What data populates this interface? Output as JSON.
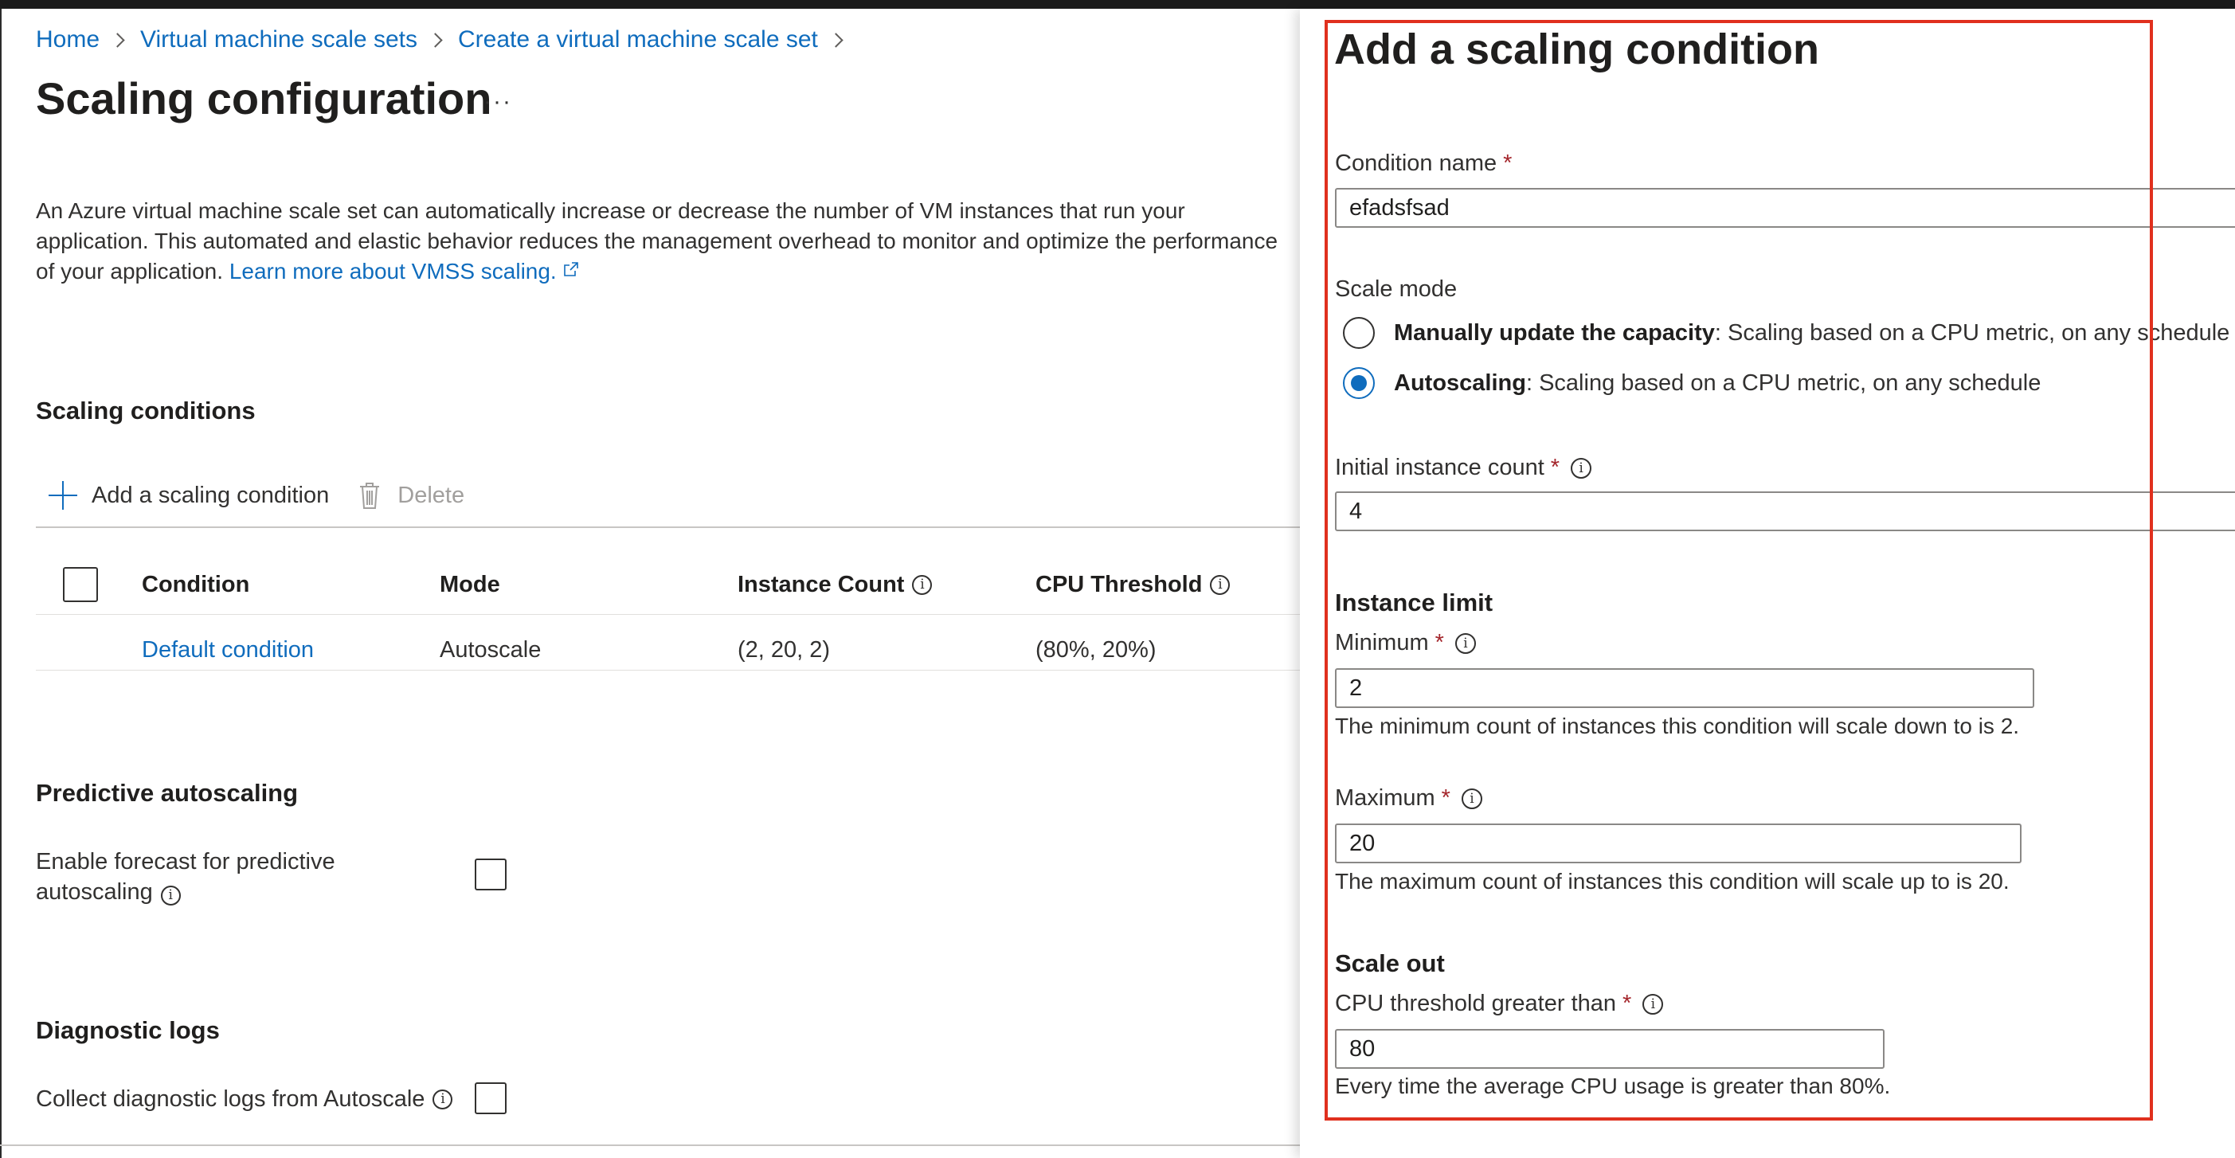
{
  "breadcrumb": {
    "home": "Home",
    "scale_sets": "Virtual machine scale sets",
    "create": "Create a virtual machine scale set"
  },
  "page": {
    "title": "Scaling configuration",
    "more": "···",
    "description_line1": "An Azure virtual machine scale set can automatically increase or decrease the number of VM instances that run your",
    "description_line2": "application. This automated and elastic behavior reduces the management overhead to monitor and optimize the performance",
    "description_line3": "of your application.",
    "learn_more": "Learn more about VMSS scaling."
  },
  "scaling_conditions": {
    "title": "Scaling conditions",
    "add_label": "Add a scaling condition",
    "delete_label": "Delete",
    "columns": [
      "Condition",
      "Mode",
      "Instance Count",
      "CPU Threshold"
    ],
    "rows": [
      {
        "condition": "Default condition",
        "mode": "Autoscale",
        "instance_count": "(2, 20, 2)",
        "cpu_threshold": "(80%, 20%)"
      }
    ]
  },
  "predictive": {
    "title": "Predictive autoscaling",
    "label_line1": "Enable forecast for predictive",
    "label_line2": "autoscaling"
  },
  "diagnostic": {
    "title": "Diagnostic logs",
    "label": "Collect diagnostic logs from Autoscale"
  },
  "panel": {
    "title": "Add a scaling condition",
    "condition_name_label": "Condition name",
    "condition_name_value": "efadsfsad",
    "scale_mode_label": "Scale mode",
    "mode_manual_bold": "Manually update the capacity",
    "mode_manual_rest": ": Scaling based on a CPU metric, on any schedule",
    "mode_auto_bold": "Autoscaling",
    "mode_auto_rest": ": Scaling based on a CPU metric, on any schedule",
    "selected_mode": "Autoscaling",
    "initial_count_label": "Initial instance count",
    "initial_count_value": "4",
    "instance_limit_title": "Instance limit",
    "minimum_label": "Minimum",
    "minimum_value": "2",
    "minimum_help": "The minimum count of instances this condition will scale down to is 2.",
    "maximum_label": "Maximum",
    "maximum_value": "20",
    "maximum_help": "The maximum count of instances this condition will scale up to is 20.",
    "scale_out_title": "Scale out",
    "cpu_greater_label": "CPU threshold greater than",
    "cpu_greater_value": "80",
    "cpu_greater_help": "Every time the average CPU usage is greater than 80%."
  },
  "common": {
    "required_mark": "*",
    "info_glyph": "i"
  },
  "colors": {
    "link": "#0f6cbd",
    "required": "#a4262c",
    "highlight": "#e0301e"
  }
}
